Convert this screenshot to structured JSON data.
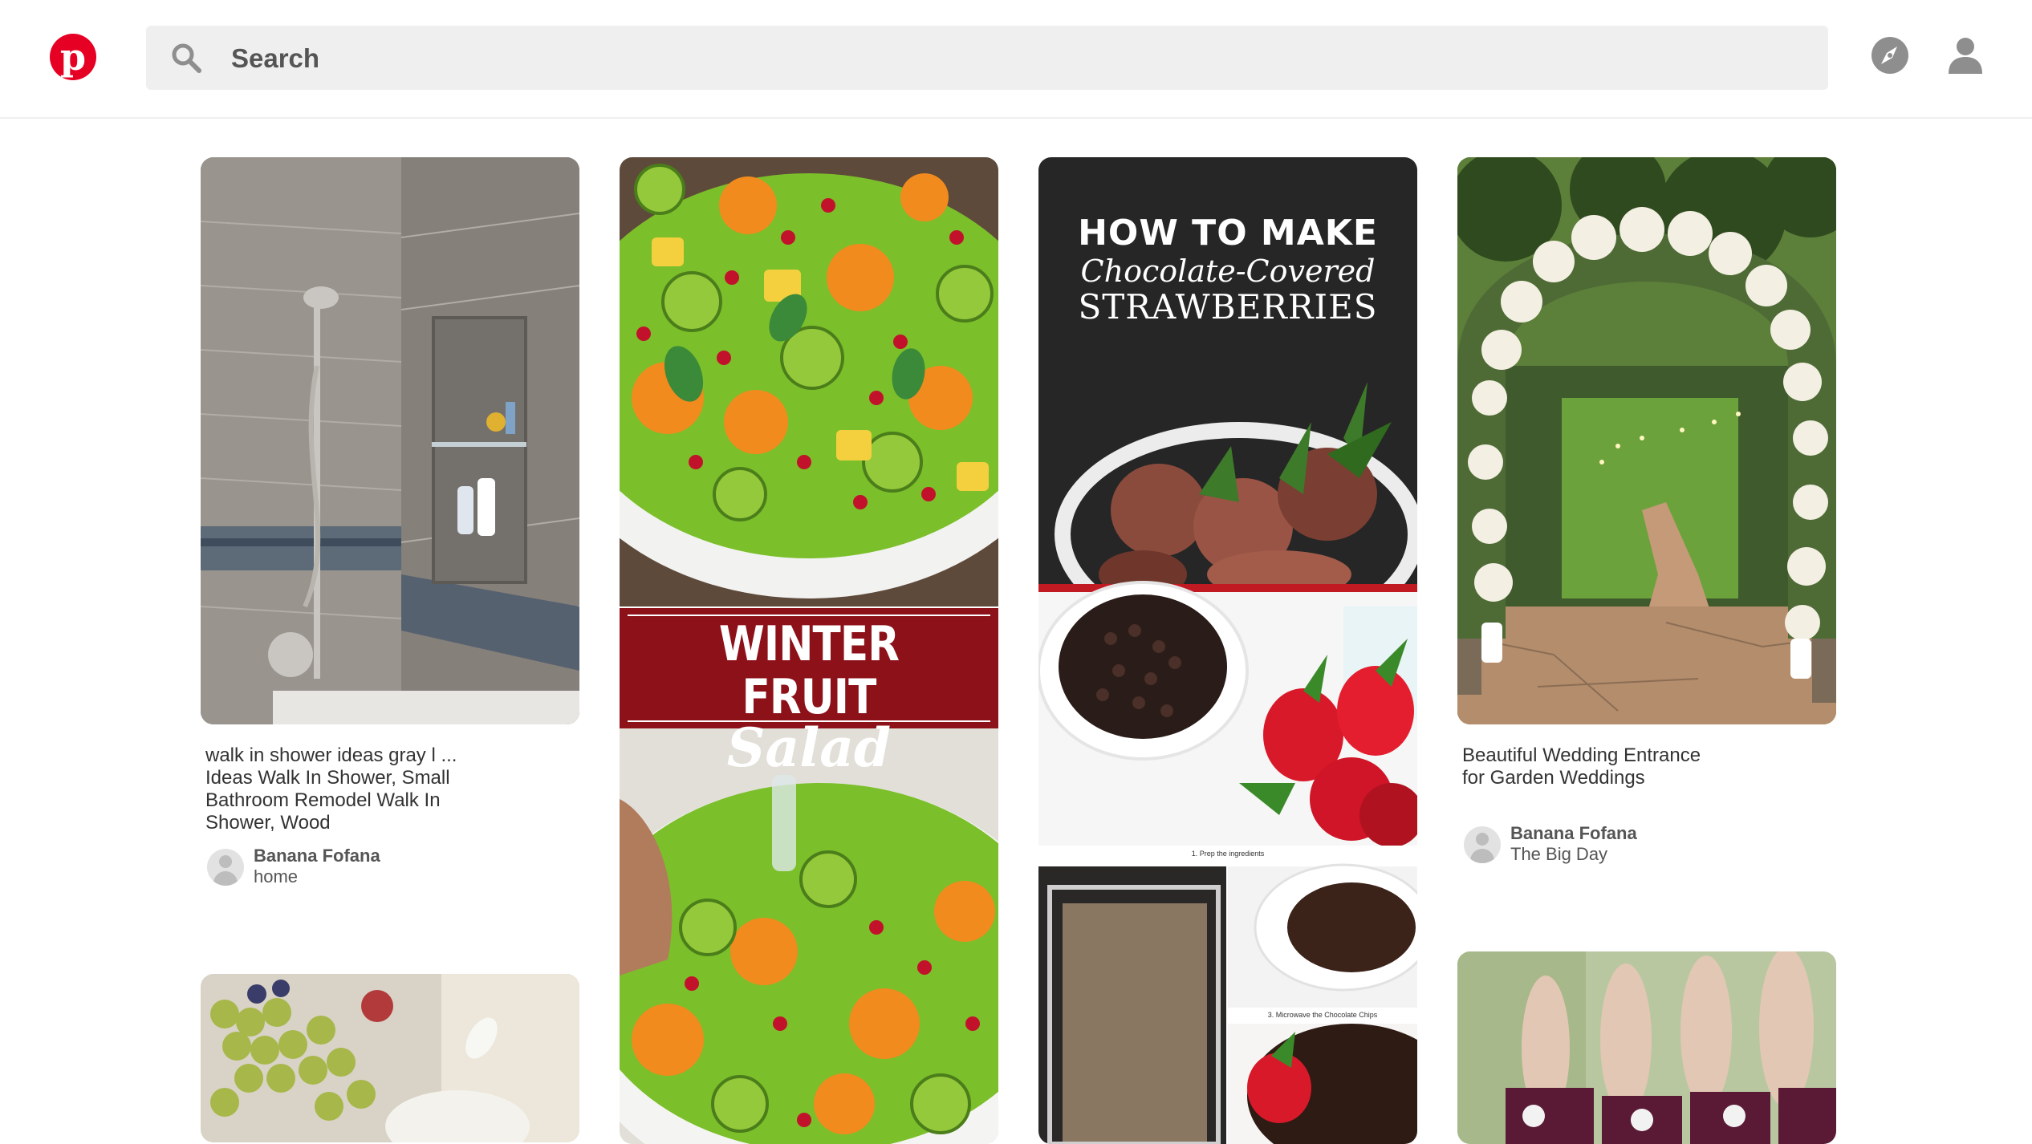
{
  "header": {
    "logo_letter": "p",
    "search_placeholder": "Search",
    "explore_icon": "compass-icon",
    "profile_icon": "user-icon"
  },
  "colors": {
    "brand": "#e60023",
    "search_bg": "#efefef",
    "wine_banner": "#8d1119"
  },
  "pins": [
    {
      "description": "walk in shower ideas gray l ... Ideas Walk In Shower, Small Bathroom Remodel Walk In Shower, Wood",
      "pinner": "Banana Fofana",
      "board": "home"
    },
    {
      "overlay_line1": "WINTER FRUIT",
      "overlay_line2": "Salad"
    },
    {
      "title_line1": "HOW TO MAKE",
      "title_line2": "Chocolate-Covered",
      "title_line3": "STRAWBERRIES",
      "step1_caption": "1. Prep the ingredients",
      "step3_caption": "3. Microwave the Chocolate Chips"
    },
    {
      "description": "Beautiful Wedding Entrance for Garden Weddings",
      "pinner": "Banana Fofana",
      "board": "The Big Day"
    }
  ]
}
